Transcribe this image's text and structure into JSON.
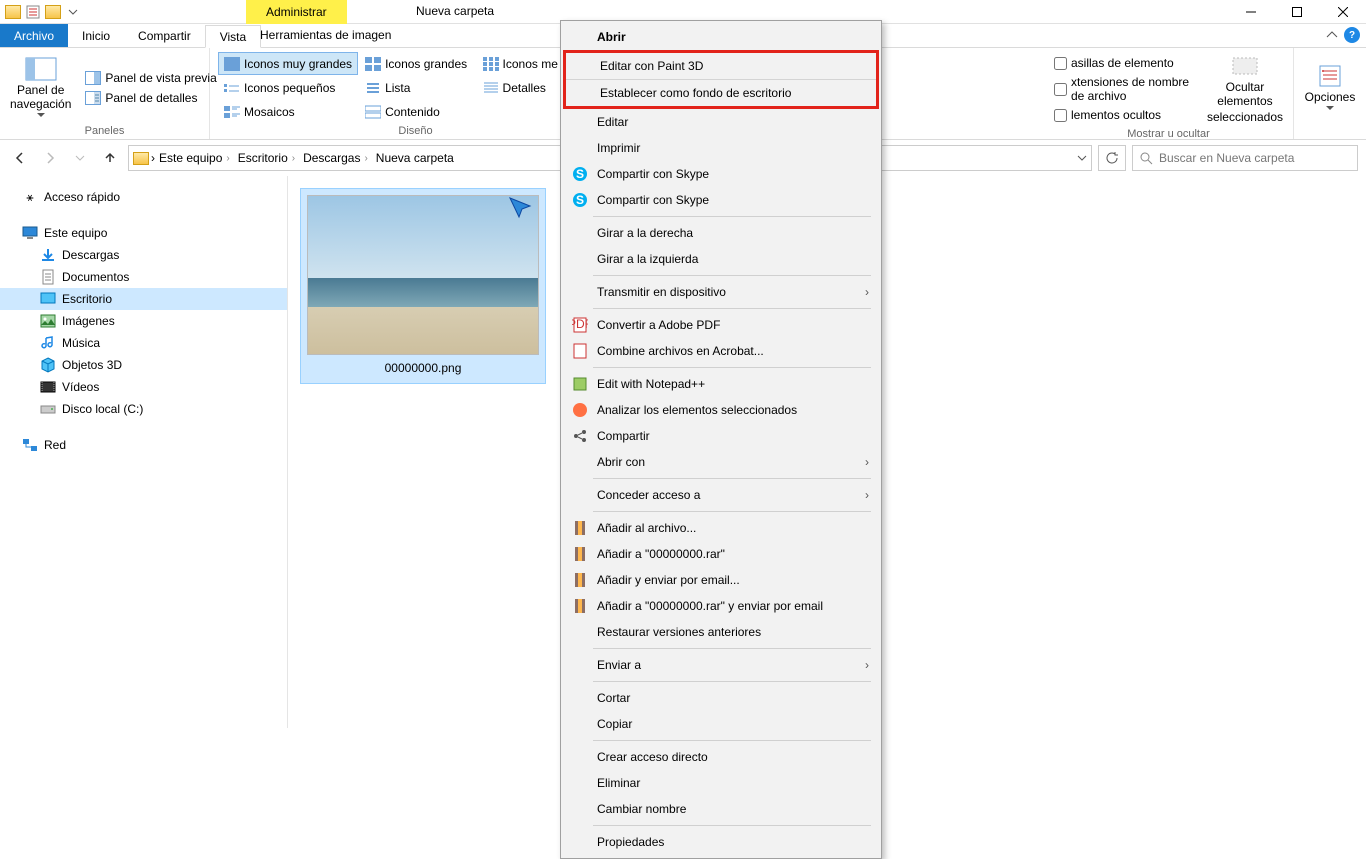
{
  "title_bar": {
    "manage": "Administrar",
    "folder_title": "Nueva carpeta"
  },
  "tabs": {
    "file": "Archivo",
    "home": "Inicio",
    "share": "Compartir",
    "view": "Vista",
    "image_tools": "Herramientas de imagen"
  },
  "ribbon": {
    "nav_pane": "Panel de navegación",
    "preview": "Panel de vista previa",
    "details_pane": "Panel de detalles",
    "panels": "Paneles",
    "icons_xl": "Iconos muy grandes",
    "icons_l": "Iconos grandes",
    "icons_m": "Iconos me",
    "icons_s": "Iconos pequeños",
    "list": "Lista",
    "details": "Detalles",
    "mosaic": "Mosaicos",
    "content": "Contenido",
    "layout": "Diseño",
    "item_chk": "asillas de elemento",
    "ext_chk": "xtensiones de nombre de archivo",
    "hidden_chk": "lementos ocultos",
    "hide_sel_l1": "Ocultar elementos",
    "hide_sel_l2": "seleccionados",
    "show_hide": "Mostrar u ocultar",
    "options": "Opciones"
  },
  "breadcrumb": {
    "pc": "Este equipo",
    "desktop": "Escritorio",
    "downloads": "Descargas",
    "folder": "Nueva carpeta"
  },
  "search": {
    "placeholder": "Buscar en Nueva carpeta"
  },
  "sidebar": {
    "quick": "Acceso rápido",
    "pc": "Este equipo",
    "downloads": "Descargas",
    "documents": "Documentos",
    "desktop": "Escritorio",
    "images": "Imágenes",
    "music": "Música",
    "objects3d": "Objetos 3D",
    "videos": "Vídeos",
    "cdrive": "Disco local (C:)",
    "network": "Red"
  },
  "thumb": {
    "filename": "00000000.png"
  },
  "ctx": {
    "open": "Abrir",
    "paint3d": "Editar con Paint 3D",
    "set_wall": "Establecer como fondo de escritorio",
    "edit": "Editar",
    "print": "Imprimir",
    "skype1": "Compartir con Skype",
    "skype2": "Compartir con Skype",
    "rot_r": "Girar a la derecha",
    "rot_l": "Girar a la izquierda",
    "cast": "Transmitir en dispositivo",
    "to_pdf": "Convertir a Adobe PDF",
    "combine": "Combine archivos en Acrobat...",
    "notepad": "Edit with Notepad++",
    "analyze": "Analizar los elementos seleccionados",
    "share": "Compartir",
    "open_with": "Abrir con",
    "grant": "Conceder acceso a",
    "add_arch": "Añadir al archivo...",
    "add_rar": "Añadir a \"00000000.rar\"",
    "send_email": "Añadir y enviar por email...",
    "rar_email": "Añadir a \"00000000.rar\" y enviar por email",
    "restore": "Restaurar versiones anteriores",
    "send_to": "Enviar a",
    "cut": "Cortar",
    "copy": "Copiar",
    "shortcut": "Crear acceso directo",
    "delete": "Eliminar",
    "rename": "Cambiar nombre",
    "properties": "Propiedades"
  }
}
